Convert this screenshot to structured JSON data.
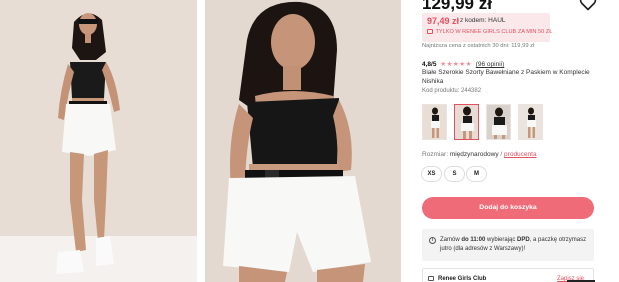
{
  "product": {
    "price": "129,99 zł",
    "promo_price": "97,49 zł",
    "promo_code_text": "z kodem: HAUL",
    "promo_club_text": "TYLKO W RENEE GIRLS CLUB ZA MIN 50 ZŁ",
    "lowest_price_text": "Najniższa cena z ostatnich 30 dni: 119,99 zł",
    "rating_score": "4,8/5",
    "rating_stars": "★★★★★",
    "rating_value": 4.8,
    "reviews_text": "(96 opinii)",
    "name": "Białe Szerokie Szorty Bawełniane z Paskiem w Komplecie Nishika",
    "code_text": "Kod produktu: 244382"
  },
  "gallery": {
    "thumbnails": [
      {
        "label": "thumbnail-1",
        "active": false
      },
      {
        "label": "thumbnail-2",
        "active": true
      },
      {
        "label": "thumbnail-3",
        "active": false
      },
      {
        "label": "thumbnail-4",
        "active": false
      }
    ]
  },
  "size": {
    "label": "Rozmiar:",
    "system": "międzynarodowy",
    "separator": "/",
    "alt_system": "producenta",
    "options": [
      "XS",
      "S",
      "M"
    ]
  },
  "actions": {
    "add_to_cart": "Dodaj do koszyka"
  },
  "delivery": {
    "text_before_time": "Zamów ",
    "time": "do 11:00",
    "text_middle": " wybierając ",
    "carrier": "DPD",
    "text_after": ", a paczkę otrzymasz jutro (dla adresów z Warszawy)!"
  },
  "club": {
    "title": "Renee Girls Club",
    "join_label": "Zapisz się"
  },
  "icons": {
    "favorite": "heart-icon",
    "info": "info-icon",
    "club": "ticket-icon"
  },
  "colors": {
    "accent": "#f06b78",
    "promo_text": "#e2515f",
    "promo_bg": "#fbe8ea"
  }
}
